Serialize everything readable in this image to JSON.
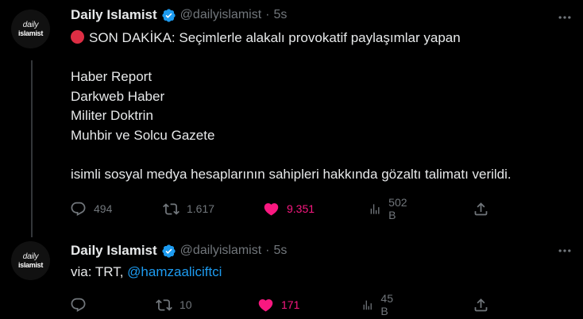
{
  "tweets": [
    {
      "avatar": {
        "line1": "daily",
        "line2": "islamist"
      },
      "author_name": "Daily Islamist",
      "handle": "@dailyislamist",
      "separator": "·",
      "time": "5s",
      "lines": [
        "SON DAKİKA: Seçimlerle alakalı provokatif paylaşımlar yapan",
        "Haber Report",
        "Darkweb Haber",
        "Militer Doktrin",
        "Muhbir ve Solcu Gazete",
        "isimli sosyal medya hesaplarının sahipleri hakkında gözaltı talimatı verildi."
      ],
      "replies": "494",
      "retweets": "1.617",
      "likes": "9.351",
      "views": "502 B"
    },
    {
      "avatar": {
        "line1": "daily",
        "line2": "islamist"
      },
      "author_name": "Daily Islamist",
      "handle": "@dailyislamist",
      "separator": "·",
      "time": "5s",
      "text_prefix": "via: TRT, ",
      "mention": "@hamzaaliciftci",
      "replies": "",
      "retweets": "10",
      "likes": "171",
      "views": "45 B"
    }
  ],
  "icons": {
    "reply": "reply-icon",
    "retweet": "retweet-icon",
    "like": "heart-icon",
    "views": "views-icon",
    "share": "share-icon",
    "more": "more-icon",
    "verified": "verified-badge-icon",
    "breaking": "red-circle-icon"
  },
  "colors": {
    "background": "#000000",
    "text": "#e7e9ea",
    "secondary": "#71767b",
    "like": "#f91880",
    "link": "#1d9bf0",
    "verified": "#1d9bf0",
    "thread_line": "#333639"
  }
}
